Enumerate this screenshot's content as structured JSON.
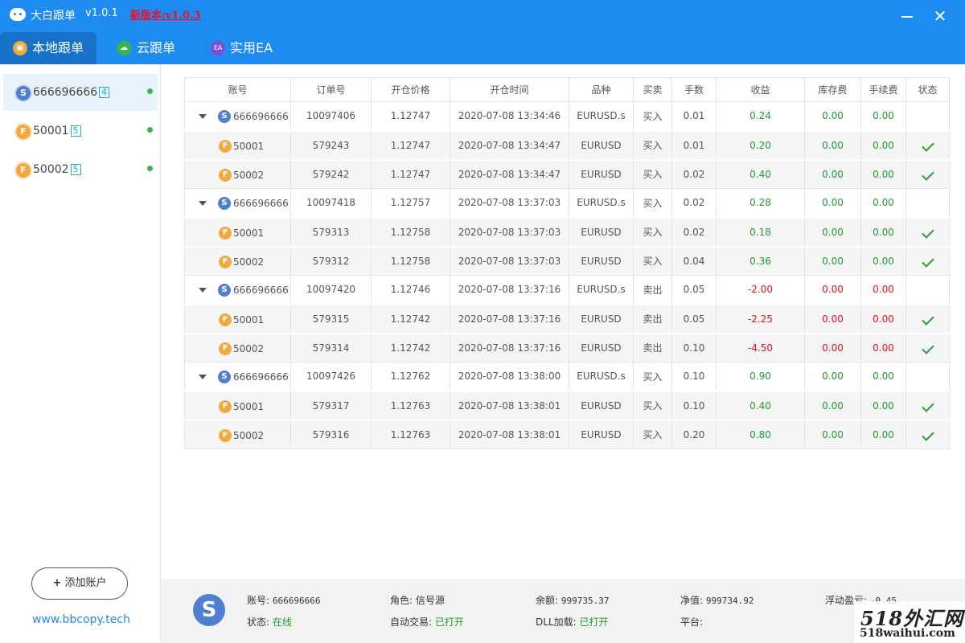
{
  "app": {
    "title": "大白跟单",
    "version": "v1.0.1",
    "new_version": "新版本:v1.0.3",
    "accent_color": "#1e8bf0"
  },
  "tabs": [
    {
      "label": "本地跟单",
      "icon": "local-follow-icon",
      "active": true
    },
    {
      "label": "云跟单",
      "icon": "cloud-follow-icon",
      "active": false
    },
    {
      "label": "实用EA",
      "icon": "ea-icon",
      "icon_text": "EA",
      "active": false
    }
  ],
  "sidebar": {
    "accounts": [
      {
        "type": "S",
        "name": "666696666",
        "count": "4",
        "online": true,
        "active": true
      },
      {
        "type": "F",
        "name": "50001",
        "count": "5",
        "online": true,
        "active": false
      },
      {
        "type": "F",
        "name": "50002",
        "count": "5",
        "online": true,
        "active": false
      }
    ],
    "add_button": "添加账户",
    "add_symbol": "+",
    "website": "www.bbcopy.tech"
  },
  "table": {
    "columns": [
      "账号",
      "订单号",
      "开仓价格",
      "开仓时间",
      "品种",
      "买卖",
      "手数",
      "收益",
      "库存费",
      "手续费",
      "状态"
    ],
    "rows": [
      {
        "kind": "master",
        "coin": "S",
        "account": "666696666",
        "order": "10097406",
        "price": "1.12747",
        "time": "2020-07-08 13:34:46",
        "symbol": "EURUSD.s",
        "side": "买入",
        "lots": "0.01",
        "profit": "0.24",
        "swap": "0.00",
        "fee": "0.00",
        "sign": "pos"
      },
      {
        "kind": "child",
        "coin": "F",
        "account": "50001",
        "order": "579243",
        "price": "1.12747",
        "time": "2020-07-08 13:34:47",
        "symbol": "EURUSD",
        "side": "买入",
        "lots": "0.01",
        "profit": "0.20",
        "swap": "0.00",
        "fee": "0.00",
        "sign": "pos"
      },
      {
        "kind": "child",
        "coin": "F",
        "account": "50002",
        "order": "579242",
        "price": "1.12747",
        "time": "2020-07-08 13:34:47",
        "symbol": "EURUSD",
        "side": "买入",
        "lots": "0.02",
        "profit": "0.40",
        "swap": "0.00",
        "fee": "0.00",
        "sign": "pos"
      },
      {
        "kind": "master",
        "coin": "S",
        "account": "666696666",
        "order": "10097418",
        "price": "1.12757",
        "time": "2020-07-08 13:37:03",
        "symbol": "EURUSD.s",
        "side": "买入",
        "lots": "0.02",
        "profit": "0.28",
        "swap": "0.00",
        "fee": "0.00",
        "sign": "pos"
      },
      {
        "kind": "child",
        "coin": "F",
        "account": "50001",
        "order": "579313",
        "price": "1.12758",
        "time": "2020-07-08 13:37:03",
        "symbol": "EURUSD",
        "side": "买入",
        "lots": "0.02",
        "profit": "0.18",
        "swap": "0.00",
        "fee": "0.00",
        "sign": "pos"
      },
      {
        "kind": "child",
        "coin": "F",
        "account": "50002",
        "order": "579312",
        "price": "1.12758",
        "time": "2020-07-08 13:37:03",
        "symbol": "EURUSD",
        "side": "买入",
        "lots": "0.04",
        "profit": "0.36",
        "swap": "0.00",
        "fee": "0.00",
        "sign": "pos"
      },
      {
        "kind": "master",
        "coin": "S",
        "account": "666696666",
        "order": "10097420",
        "price": "1.12746",
        "time": "2020-07-08 13:37:16",
        "symbol": "EURUSD.s",
        "side": "卖出",
        "lots": "0.05",
        "profit": "-2.00",
        "swap": "0.00",
        "fee": "0.00",
        "sign": "neg"
      },
      {
        "kind": "child",
        "coin": "F",
        "account": "50001",
        "order": "579315",
        "price": "1.12742",
        "time": "2020-07-08 13:37:16",
        "symbol": "EURUSD",
        "side": "卖出",
        "lots": "0.05",
        "profit": "-2.25",
        "swap": "0.00",
        "fee": "0.00",
        "sign": "neg"
      },
      {
        "kind": "child",
        "coin": "F",
        "account": "50002",
        "order": "579314",
        "price": "1.12742",
        "time": "2020-07-08 13:37:16",
        "symbol": "EURUSD",
        "side": "卖出",
        "lots": "0.10",
        "profit": "-4.50",
        "swap": "0.00",
        "fee": "0.00",
        "sign": "neg"
      },
      {
        "kind": "master",
        "coin": "S",
        "account": "666696666",
        "order": "10097426",
        "price": "1.12762",
        "time": "2020-07-08 13:38:00",
        "symbol": "EURUSD.s",
        "side": "买入",
        "lots": "0.10",
        "profit": "0.90",
        "swap": "0.00",
        "fee": "0.00",
        "sign": "pos"
      },
      {
        "kind": "child",
        "coin": "F",
        "account": "50001",
        "order": "579317",
        "price": "1.12763",
        "time": "2020-07-08 13:38:01",
        "symbol": "EURUSD",
        "side": "买入",
        "lots": "0.10",
        "profit": "0.40",
        "swap": "0.00",
        "fee": "0.00",
        "sign": "pos"
      },
      {
        "kind": "child",
        "coin": "F",
        "account": "50002",
        "order": "579316",
        "price": "1.12763",
        "time": "2020-07-08 13:38:01",
        "symbol": "EURUSD",
        "side": "买入",
        "lots": "0.20",
        "profit": "0.80",
        "swap": "0.00",
        "fee": "0.00",
        "sign": "pos"
      }
    ]
  },
  "footer": {
    "coin": "S",
    "account_label": "账号:",
    "account_value": "666696666",
    "role_label": "角色:",
    "role_value": "信号源",
    "balance_label": "余额:",
    "balance_value": "999735.37",
    "equity_label": "净值:",
    "equity_value": "999734.92",
    "floating_label": "浮动盈亏:",
    "floating_value": "-0.45",
    "status_label": "状态:",
    "status_value": "在线",
    "autotrade_label": "自动交易:",
    "autotrade_value": "已打开",
    "dll_label": "DLL加载:",
    "dll_value": "已打开",
    "platform_label": "平台:"
  },
  "watermark": {
    "line1": "518外汇网",
    "line2": "518waihui.com"
  }
}
